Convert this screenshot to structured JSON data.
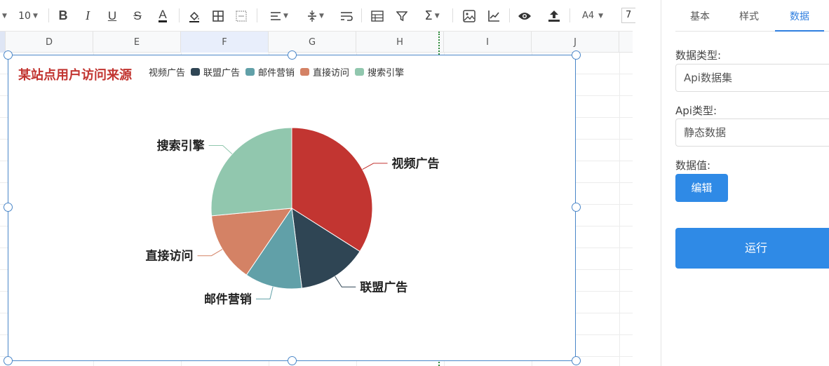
{
  "toolbar": {
    "font_size": "10",
    "paper_size": "A4",
    "zoom_partial": "7",
    "icons": [
      "bold-icon",
      "italic-icon",
      "underline-icon",
      "strikethrough-icon",
      "font-color-icon",
      "fill-color-icon",
      "borders-icon",
      "merge-cells-icon",
      "align-icon",
      "valign-icon",
      "wrap-icon",
      "table-icon",
      "filter-icon",
      "sum-icon",
      "image-icon",
      "chart-icon",
      "preview-icon",
      "upload-icon"
    ]
  },
  "columns": [
    "D",
    "E",
    "F",
    "G",
    "H",
    "I",
    "J"
  ],
  "chart_data": {
    "type": "pie",
    "title": "某站点用户访问来源",
    "categories": [
      "视频广告",
      "联盟广告",
      "邮件营销",
      "直接访问",
      "搜索引擎"
    ],
    "values": [
      34.0,
      14.0,
      11.5,
      14.0,
      26.5
    ],
    "colors": [
      "#c23531",
      "#2f4554",
      "#61a0a8",
      "#d48265",
      "#91c7ae"
    ],
    "legend_position": "top",
    "legend_partial_first": "视频广告"
  },
  "panel": {
    "tabs": [
      "基本",
      "样式",
      "数据"
    ],
    "active_tab": "数据",
    "data_type_label": "数据类型:",
    "data_type_value": "Api数据集",
    "api_type_label": "Api类型:",
    "api_type_value": "静态数据",
    "data_value_label": "数据值:",
    "edit_button": "编辑",
    "run_button": "运行"
  },
  "colors": {
    "accent": "#2f8ae6",
    "selection": "#4a86c8"
  }
}
